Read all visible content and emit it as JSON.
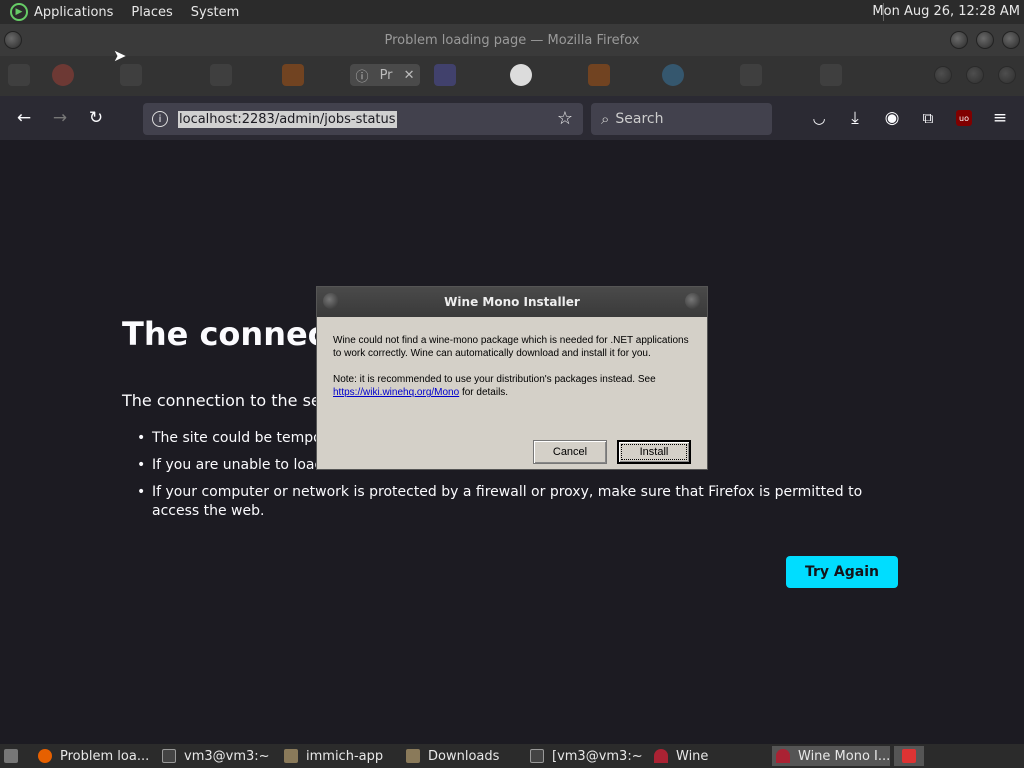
{
  "top_panel": {
    "menus": [
      "Applications",
      "Places",
      "System"
    ],
    "clock": "Mon Aug 26, 12:28 AM"
  },
  "window": {
    "title": "Problem loading page — Mozilla Firefox"
  },
  "tabs": {
    "active_label": "Pr"
  },
  "navbar": {
    "url": "localhost:2283/admin/jobs-status",
    "search_placeholder": "Search"
  },
  "page": {
    "title": "The connecti",
    "description": "The connection to the ser",
    "bullets": [
      "The site could be tempor",
      "If you are unable to load",
      "If your computer or network is protected by a firewall or proxy, make sure that Firefox is permitted to access the web."
    ],
    "try_again": "Try Again"
  },
  "dialog": {
    "title": "Wine Mono Installer",
    "message": "Wine could not find a wine-mono package which is needed for .NET applications to work correctly. Wine can automatically download and install it for you.",
    "note_prefix": "Note: it is recommended to use your distribution's packages instead. See",
    "link": "https://wiki.winehq.org/Mono",
    "note_suffix": "for details.",
    "cancel": "Cancel",
    "install": "Install"
  },
  "taskbar": {
    "items": [
      {
        "label": "Problem loa...",
        "color": "#e66000"
      },
      {
        "label": "vm3@vm3:~",
        "color": "#444444"
      },
      {
        "label": "immich-app",
        "color": "#8a7a5a"
      },
      {
        "label": "Downloads",
        "color": "#8a7a5a"
      },
      {
        "label": "[vm3@vm3:~]",
        "color": "#444444"
      },
      {
        "label": "Wine",
        "color": "#aa2233"
      },
      {
        "label": "Wine Mono I...",
        "color": "#aa2233"
      }
    ]
  }
}
